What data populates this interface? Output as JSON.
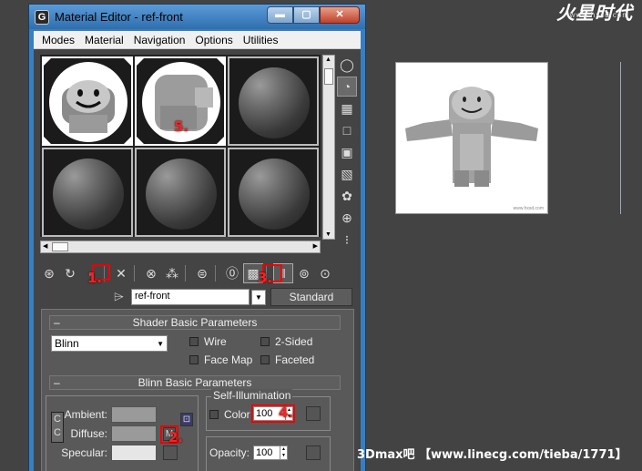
{
  "watermark": {
    "logo_text": "火星时代",
    "site": "www.hxsd.com"
  },
  "credit": "3Dmax吧 【www.linecg.com/tieba/1771】",
  "window": {
    "title": "Material Editor - ref-front",
    "app_icon": "3ds-max-icon",
    "controls": {
      "minimize": "▬",
      "maximize": "▢",
      "close": "✕"
    }
  },
  "menu": {
    "items": [
      "Modes",
      "Material",
      "Navigation",
      "Options",
      "Utilities"
    ]
  },
  "side_tools": [
    "sample-type-icon",
    "backlight-icon",
    "background-icon",
    "sample-uv-tiling-icon",
    "video-color-check-icon",
    "make-preview-icon",
    "options-icon",
    "select-by-material-icon",
    "material-map-navigator-icon"
  ],
  "toolbar": {
    "tools": [
      "get-material-icon",
      "put-to-scene-icon",
      "assign-to-selection-icon",
      "reset-map-icon",
      "make-copy-icon",
      "make-unique-icon",
      "put-to-library-icon",
      "material-id-icon",
      "show-map-icon",
      "show-end-result-icon",
      "go-to-parent-icon",
      "go-forward-icon"
    ]
  },
  "annotations": {
    "a1": "1.",
    "a2": "2.",
    "a3": "3.",
    "a4": "4.",
    "a5": "5."
  },
  "material": {
    "name": "ref-front",
    "type": "Standard"
  },
  "shader": {
    "rollout_title": "Shader Basic Parameters",
    "shader_type": "Blinn",
    "options": {
      "wire": "Wire",
      "two_sided": "2-Sided",
      "face_map": "Face Map",
      "faceted": "Faceted"
    }
  },
  "blinn": {
    "rollout_title": "Blinn Basic Parameters",
    "ambient_label": "Ambient:",
    "diffuse_label": "Diffuse:",
    "specular_label": "Specular:",
    "ambient_color": "#9a9a9a",
    "diffuse_color": "#9a9a9a",
    "specular_color": "#e6e6e6",
    "lock_symbol": "C",
    "map_label": "M",
    "self_illum": {
      "group_label": "Self-Illumination",
      "color_label": "Color",
      "value": "100"
    },
    "opacity": {
      "label": "Opacity:",
      "value": "100"
    }
  },
  "rollout_minus": "–"
}
